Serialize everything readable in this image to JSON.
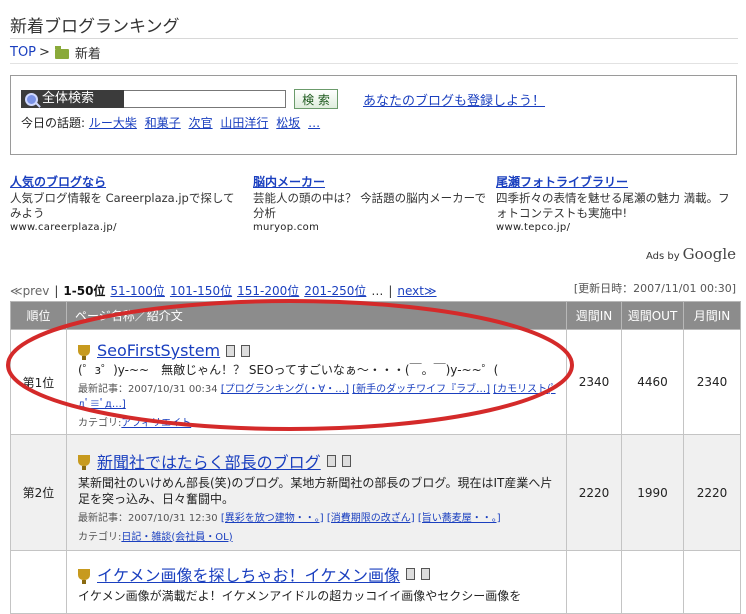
{
  "header": {
    "title": "新着ブログランキング",
    "breadcrumb": {
      "top": "TOP",
      "separator": ">",
      "current": "新着"
    }
  },
  "search": {
    "label": "全体検索",
    "input_value": "",
    "button_label": "検 索",
    "register_link": "あなたのブログも登録しよう！",
    "topics_label": "今日の話題:",
    "topics": [
      "ルー大柴",
      "和菓子",
      "次官",
      "山田洋行",
      "松坂",
      "…"
    ]
  },
  "ads": [
    {
      "title": "人気のブログなら",
      "desc": "人気ブログ情報を Careerplaza.jpで探してみよう",
      "url": "www.careerplaza.jp/"
    },
    {
      "title": "脳内メーカー",
      "desc": "芸能人の頭の中は？ 今話題の脳内メーカーで分析",
      "url": "muryop.com"
    },
    {
      "title": "尾瀬フォトライブラリー",
      "desc": "四季折々の表情を魅せる尾瀬の魅力 満載。フォトコンテストも実施中!",
      "url": "www.tepco.jp/"
    }
  ],
  "ads_by": {
    "prefix": "Ads by",
    "brand": "Google"
  },
  "pager": {
    "prev": "≪prev",
    "sep": "|",
    "current": "1-50位",
    "pages": [
      "51-100位",
      "101-150位",
      "151-200位",
      "201-250位"
    ],
    "more": "…",
    "next": "next≫",
    "updated": "[更新日時：2007/11/01 00:30]"
  },
  "table": {
    "headers": {
      "rank": "順位",
      "page": "ページ名称／紹介文",
      "weekly_in": "週間IN",
      "weekly_out": "週間OUT",
      "monthly_in": "月間IN"
    },
    "rows": [
      {
        "rank": "第1位",
        "name": "SeoFirstSystem",
        "desc": "(゜з゜)y-~~　無敵じゃん！？ SEOってすごいなぁ～・・・(￣。￣)y-~~゜(",
        "latest_label": "最新記事：2007/10/31 00:34",
        "articles": [
          "[プログランキング(・∀・…]",
          "[新手のダッチワイフ『ラブ…]",
          "[カモリスト(ﾟдﾟ≡ﾟд…]"
        ],
        "category_label": "カテゴリ:",
        "category": "アフィリエイト",
        "weekly_in": "2340",
        "weekly_out": "4460",
        "monthly_in": "2340"
      },
      {
        "rank": "第2位",
        "name": "新聞社ではたらく部長のブログ",
        "desc": "某新聞社のいけめん部長(笑)のブログ。某地方新聞社の部長のブログ。現在はIT産業へ片足を突っ込み、日々奮闘中。",
        "latest_label": "最新記事：2007/10/31 12:30",
        "articles": [
          "[異彩を放つ建物・・。]",
          "[消費期限の改ざん]",
          "[旨い蕎麦屋・・。]"
        ],
        "category_label": "カテゴリ:",
        "category": "日記・雑談(会社員・OL)",
        "weekly_in": "2220",
        "weekly_out": "1990",
        "monthly_in": "2220"
      },
      {
        "rank": "",
        "name": "イケメン画像を探しちゃお！イケメン画像",
        "desc": "イケメン画像が満載だよ！イケメンアイドルの超カッコイイ画像やセクシー画像を",
        "weekly_in": "",
        "weekly_out": "",
        "monthly_in": ""
      }
    ]
  },
  "colors": {
    "link": "#1a3fbf",
    "header_bg": "#8c8c8c",
    "annotation_ellipse": "#d42a2a"
  }
}
